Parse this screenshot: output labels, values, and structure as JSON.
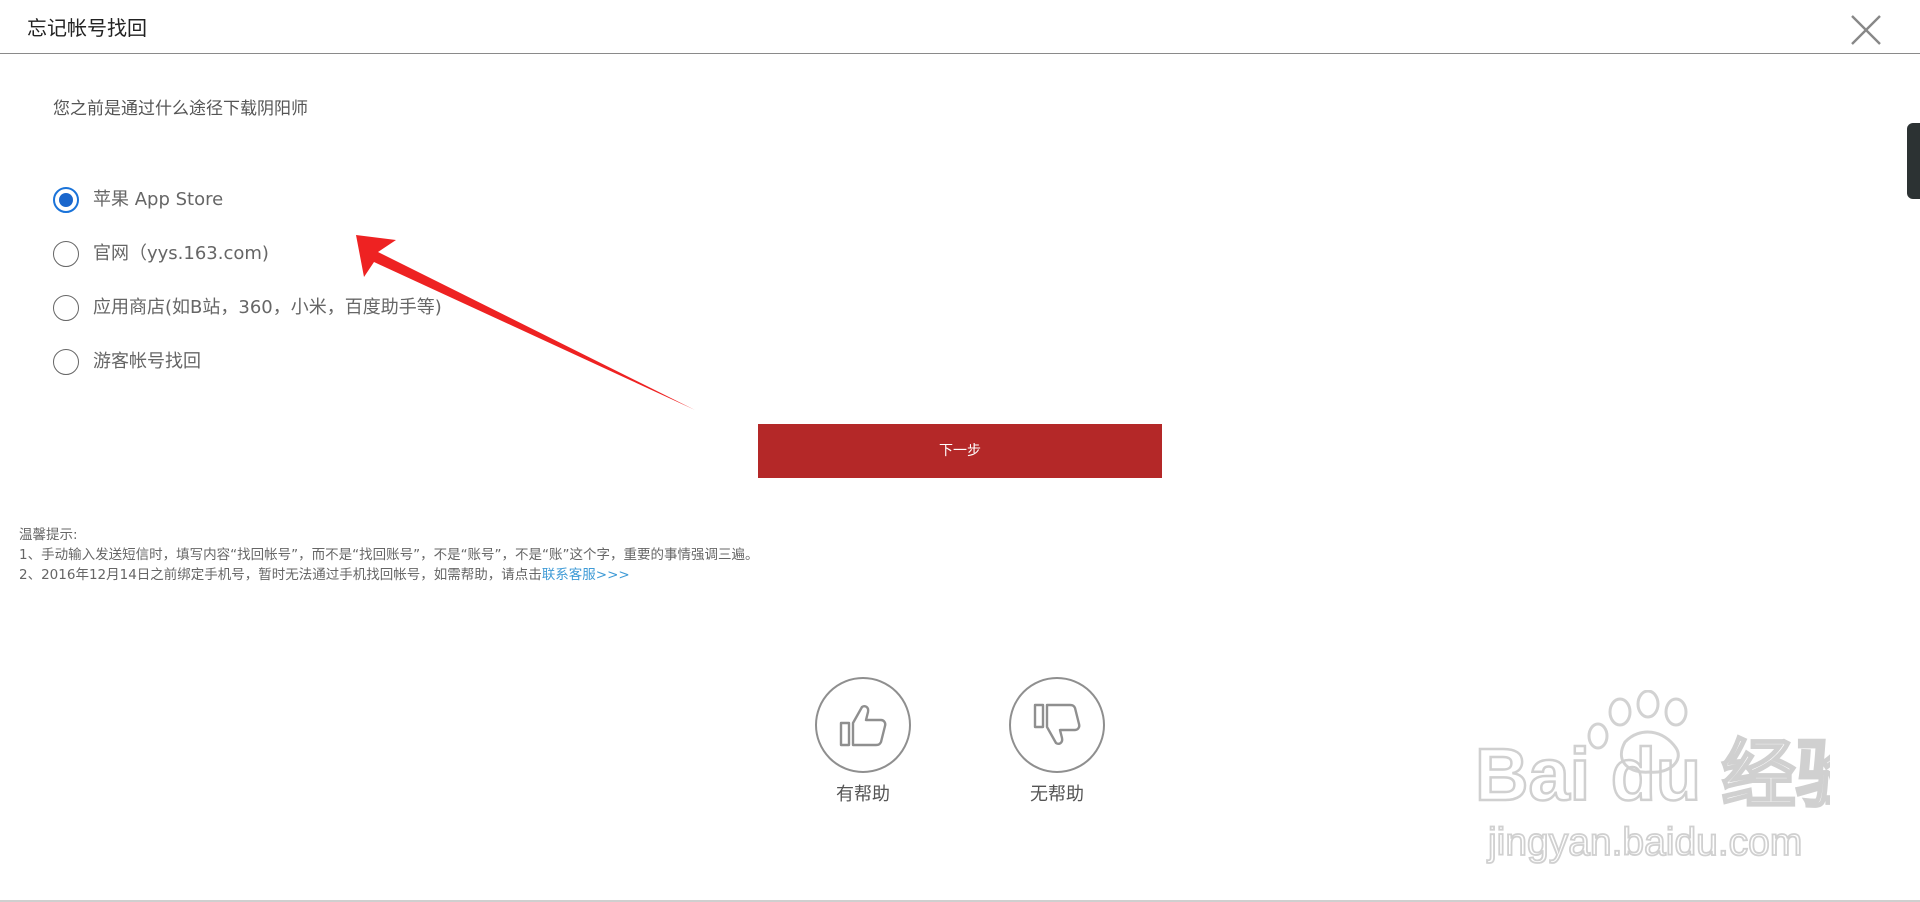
{
  "dialog": {
    "title": "忘记帐号找回"
  },
  "question": "您之前是通过什么途径下载阴阳师",
  "options": [
    {
      "label": "苹果 App Store",
      "checked": true
    },
    {
      "label": "官网（yys.163.com)",
      "checked": false
    },
    {
      "label": "应用商店(如B站，360，小米，百度助手等)",
      "checked": false
    },
    {
      "label": "游客帐号找回",
      "checked": false
    }
  ],
  "next_button": "下一步",
  "tips": {
    "heading": "温馨提示:",
    "line1": "1、手动输入发送短信时，填写内容“找回帐号”，而不是“找回账号”，不是“账号”，不是“账”这个字，重要的事情强调三遍。",
    "line2_prefix": "2、2016年12月14日之前绑定手机号，暂时无法通过手机找回帐号，如需帮助，请点击",
    "line2_link": "联系客服>>>"
  },
  "feedback": {
    "helpful": "有帮助",
    "not_helpful": "无帮助"
  },
  "watermark": {
    "brand": "Bai du 经验",
    "url": "jingyan.baidu.com"
  },
  "colors": {
    "primary_button": "#b42828",
    "radio_checked": "#1a66cc",
    "link": "#3e9ad6",
    "arrow": "#ee2222"
  },
  "icons": {
    "close": "close-icon",
    "thumbs_up": "thumbs-up-icon",
    "thumbs_down": "thumbs-down-icon"
  }
}
